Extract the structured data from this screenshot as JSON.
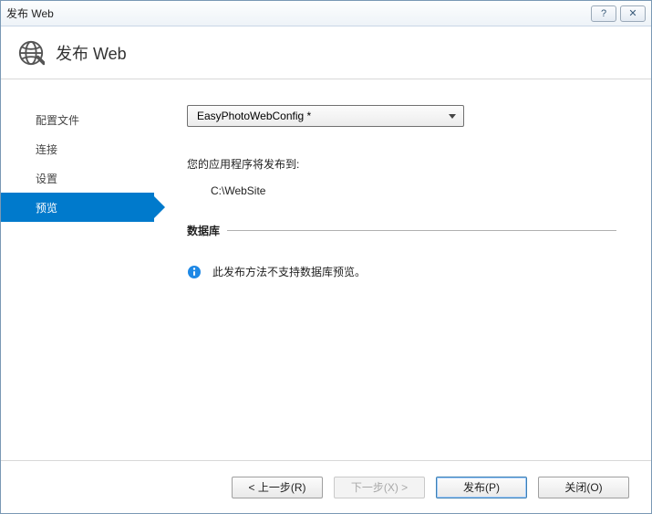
{
  "titlebar": {
    "title": "发布 Web"
  },
  "header": {
    "title": "发布 Web"
  },
  "sidebar": {
    "items": [
      {
        "label": "配置文件"
      },
      {
        "label": "连接"
      },
      {
        "label": "设置"
      },
      {
        "label": "预览"
      }
    ]
  },
  "content": {
    "profile_dropdown": "EasyPhotoWebConfig *",
    "publish_target_label": "您的应用程序将发布到:",
    "publish_target_value": "C:\\WebSite",
    "database_section_title": "数据库",
    "database_message": "此发布方法不支持数据库预览。"
  },
  "footer": {
    "prev_label": "< 上一步(R)",
    "next_label": "下一步(X) >",
    "publish_label": "发布(P)",
    "close_label": "关闭(O)"
  }
}
